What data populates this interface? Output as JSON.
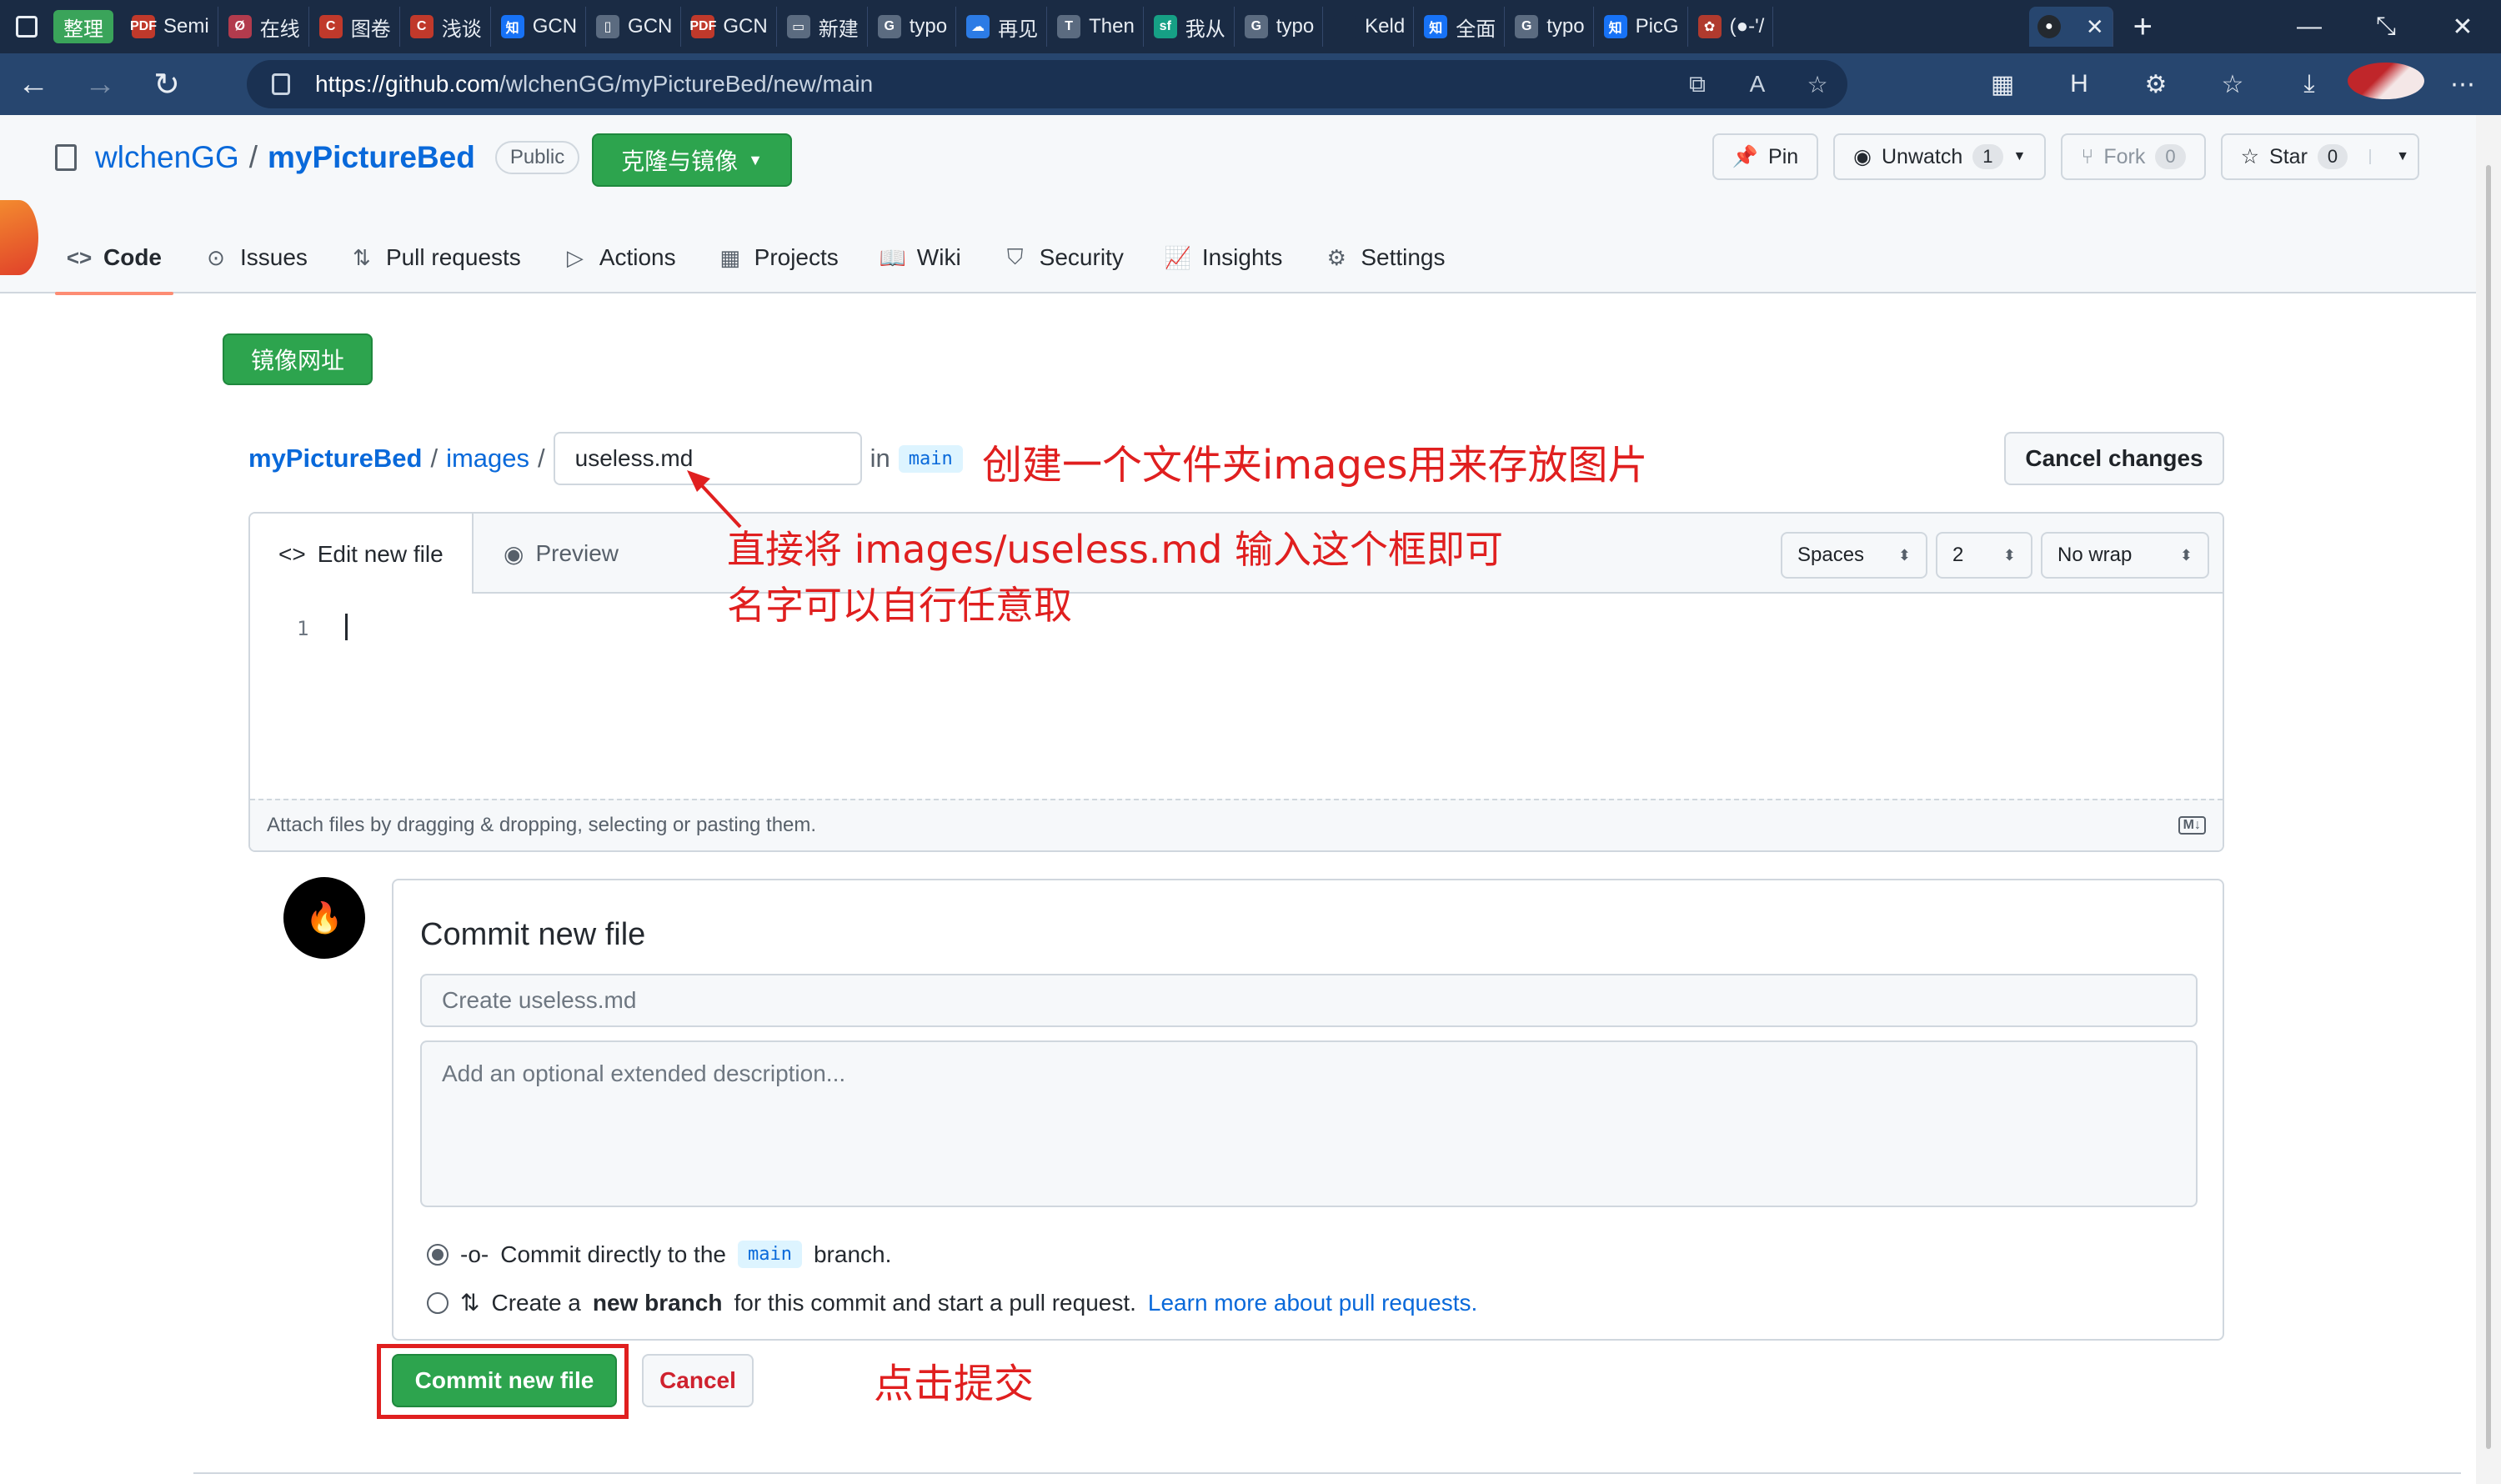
{
  "browser": {
    "tab_group": "整理",
    "tabs": [
      {
        "label": "Semi",
        "fav": "PDF",
        "color": "#c0392b"
      },
      {
        "label": "在线",
        "fav": "Ø",
        "color": "#b23b4d"
      },
      {
        "label": "图卷",
        "fav": "C",
        "color": "#c0392b"
      },
      {
        "label": "浅谈",
        "fav": "C",
        "color": "#c0392b"
      },
      {
        "label": "GCN",
        "fav": "知",
        "color": "#1772f6"
      },
      {
        "label": "GCN",
        "fav": "▯",
        "color": "#5b6b80"
      },
      {
        "label": "GCN",
        "fav": "PDF",
        "color": "#c0392b"
      },
      {
        "label": "新建",
        "fav": "▭",
        "color": "#5b6b80"
      },
      {
        "label": "typo",
        "fav": "G",
        "color": "#5b6b80"
      },
      {
        "label": "再见",
        "fav": "☁",
        "color": "#2c7be5"
      },
      {
        "label": "Then",
        "fav": "T",
        "color": "#5b6b80"
      },
      {
        "label": "我从",
        "fav": "sf",
        "color": "#16a085"
      },
      {
        "label": "typo",
        "fav": "G",
        "color": "#5b6b80"
      },
      {
        "label": "Keld",
        "fav": "",
        "color": "#1a2b44"
      },
      {
        "label": "全面",
        "fav": "知",
        "color": "#1772f6"
      },
      {
        "label": "typo",
        "fav": "G",
        "color": "#5b6b80"
      },
      {
        "label": "PicG",
        "fav": "知",
        "color": "#1772f6"
      },
      {
        "label": "(●-'/",
        "fav": "✿",
        "color": "#b03a2e"
      }
    ],
    "url_host": "https://github.com",
    "url_path": "/wlchenGG/myPictureBed/new/main"
  },
  "repo": {
    "owner": "wlchenGG",
    "separator": "/",
    "name": "myPictureBed",
    "visibility": "Public",
    "clone_button": "克隆与镜像",
    "pin": "Pin",
    "unwatch": "Unwatch",
    "unwatch_count": "1",
    "fork": "Fork",
    "fork_count": "0",
    "star": "Star",
    "star_count": "0"
  },
  "nav": [
    {
      "label": "Code",
      "icon": "code-icon",
      "glyph": "<>"
    },
    {
      "label": "Issues",
      "icon": "issue-icon",
      "glyph": "⊙"
    },
    {
      "label": "Pull requests",
      "icon": "pull-request-icon",
      "glyph": "⇅"
    },
    {
      "label": "Actions",
      "icon": "play-icon",
      "glyph": "▷"
    },
    {
      "label": "Projects",
      "icon": "table-icon",
      "glyph": "▦"
    },
    {
      "label": "Wiki",
      "icon": "book-icon",
      "glyph": "📖"
    },
    {
      "label": "Security",
      "icon": "shield-icon",
      "glyph": "⛉"
    },
    {
      "label": "Insights",
      "icon": "graph-icon",
      "glyph": "📈"
    },
    {
      "label": "Settings",
      "icon": "gear-icon",
      "glyph": "⚙"
    }
  ],
  "mirror_button": "镜像网址",
  "path": {
    "repo": "myPictureBed",
    "sep": "/",
    "folder": "images",
    "filename": "useless.md",
    "in": "in",
    "branch": "main"
  },
  "cancel_changes": "Cancel changes",
  "editor": {
    "edit_tab": "Edit new file",
    "preview_tab": "Preview",
    "indent_mode": "Spaces",
    "indent_size": "2",
    "wrap_mode": "No wrap",
    "line_number": "1",
    "attach_hint": "Attach files by dragging & dropping, selecting or pasting them.",
    "markdown_icon": "M↓"
  },
  "commit": {
    "title": "Commit new file",
    "summary_placeholder": "Create useless.md",
    "description_placeholder": "Add an optional extended description...",
    "option1_pre": "Commit directly to the",
    "option1_branch": "main",
    "option1_post": "branch.",
    "option2_pre": "Create a",
    "option2_strong": "new branch",
    "option2_post": "for this commit and start a pull request.",
    "option2_link": "Learn more about pull requests.",
    "commit_button": "Commit new file",
    "cancel_button": "Cancel"
  },
  "annotations": {
    "a1": "创建一个文件夹images用来存放图片",
    "a2_line1": "直接将 images/useless.md 输入这个框即可",
    "a2_line2": "名字可以自行任意取",
    "a3": "点击提交"
  },
  "colors": {
    "accent_green": "#2da44e",
    "link_blue": "#0969da",
    "annotation_red": "#e01f1f",
    "browser_dark": "#1a2b44"
  }
}
